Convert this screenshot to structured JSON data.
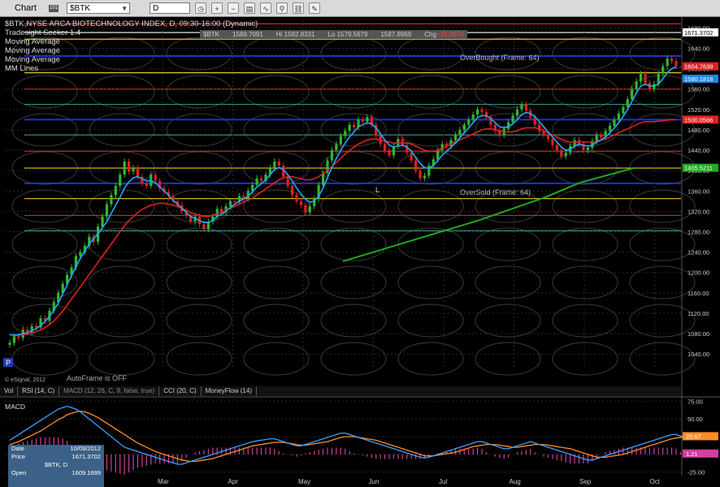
{
  "toolbar": {
    "title": "Chart",
    "symbol": "$BTK",
    "interval": "D",
    "badge": "101"
  },
  "header": {
    "title_line": "$BTK,NYSE ARCA BIOTECHNOLOGY INDEX, D, 09:30-16:00 (Dynamic)",
    "studies": [
      "Tradesight Seeker 1.4",
      "Moving Average",
      "Moving Average",
      "Moving Average",
      "MM Lines"
    ]
  },
  "quote": {
    "symbol": "$BTK",
    "high": "1589.7091",
    "high_label": "Hi",
    "high_value": "1592.8331",
    "low_label": "Lo",
    "low_value": "1579.5679",
    "last": "1587.8969",
    "change_label": "Chg",
    "change": "-15.0976"
  },
  "annotations": {
    "overbought": "OverBought (Frame: 64)",
    "oversold": "OverSold (Frame: 64)",
    "copyright": "© eSignal, 2012",
    "autoframe": "AutoFrame is OFF",
    "p_marker": "P",
    "l_marker": "L"
  },
  "tabs": [
    "Vol",
    "RSI (14, C)",
    "MACD (12, 26, C, 9, false, true)",
    "CCI (20, C)",
    "MoneyFlow (14)"
  ],
  "indicator": {
    "name": "MACD"
  },
  "infobox": {
    "date_label": "Date",
    "date": "10/09/2012",
    "price_label": "Price",
    "price": "1671.3702",
    "symbol": "$BTK, D",
    "open_label": "Open",
    "open": "1609.1699"
  },
  "colors": {
    "up": "#2fb82f",
    "down": "#e02020",
    "ma_blue": "#22a8ff",
    "ma_red": "#e02020",
    "ma_green": "#1eaa1e",
    "macd_line": "#3aa0ff",
    "signal_line": "#ff8c2a",
    "hist": "#d040a0"
  },
  "chart_data": [
    {
      "type": "candlestick",
      "x_tick_labels": [
        "Mar",
        "Apr",
        "May",
        "Jun",
        "Jul",
        "Aug",
        "Sep",
        "Oct"
      ],
      "y_ticks": [
        1040,
        1080,
        1120,
        1160,
        1200,
        1240,
        1280,
        1320,
        1360,
        1400,
        1440,
        1480,
        1520,
        1560,
        1600,
        1640,
        1680
      ],
      "ylim": [
        1010,
        1695
      ],
      "price_labels": [
        {
          "value": 1671.3702,
          "text": "1671.3702",
          "bg": "#ffffff",
          "fg": "#000000"
        },
        {
          "value": 1604.7639,
          "text": "1604.7639",
          "bg": "#e02020",
          "fg": "#ffffff"
        },
        {
          "value": 1580.1818,
          "text": "1580.1818",
          "bg": "#1e88e5",
          "fg": "#ffffff"
        },
        {
          "value": 1500.0566,
          "text": "1500.0566",
          "bg": "#e02020",
          "fg": "#ffffff"
        },
        {
          "value": 1405.5211,
          "text": "1405.5211",
          "bg": "#22aa22",
          "fg": "#ffffff"
        }
      ],
      "series": [
        {
          "values": [
            1062,
            1075,
            1072,
            1088,
            1082,
            1095,
            1092,
            1110,
            1105,
            1125,
            1142,
            1160,
            1178,
            1195,
            1210,
            1232,
            1240,
            1252,
            1270,
            1260,
            1290,
            1310,
            1334,
            1352,
            1370,
            1392,
            1418,
            1398,
            1405,
            1388,
            1375,
            1370,
            1392,
            1380,
            1365,
            1358,
            1350,
            1340,
            1332,
            1320,
            1312,
            1300,
            1310,
            1295,
            1285,
            1300,
            1310,
            1325,
            1318,
            1330,
            1340,
            1338,
            1350,
            1345,
            1360,
            1372,
            1385,
            1380,
            1392,
            1405,
            1418,
            1410,
            1388,
            1370,
            1352,
            1340,
            1332,
            1318,
            1330,
            1345,
            1372,
            1395,
            1420,
            1440,
            1452,
            1468,
            1478,
            1490,
            1485,
            1500,
            1496,
            1505,
            1490,
            1470,
            1452,
            1440,
            1430,
            1448,
            1462,
            1450,
            1435,
            1420,
            1400,
            1385,
            1390,
            1410,
            1422,
            1440,
            1452,
            1448,
            1460,
            1470,
            1480,
            1490,
            1500,
            1510,
            1520,
            1515,
            1505,
            1490,
            1478,
            1470,
            1482,
            1495,
            1508,
            1520,
            1530,
            1518,
            1505,
            1490,
            1478,
            1470,
            1462,
            1450,
            1440,
            1428,
            1435,
            1448,
            1460,
            1452,
            1440,
            1445,
            1458,
            1470,
            1465,
            1478,
            1488,
            1500,
            1512,
            1525,
            1540,
            1560,
            1575,
            1590,
            1572,
            1560,
            1570,
            1590,
            1605,
            1620,
            1615,
            1605
          ]
        },
        {
          "name": "",
          "values": [
            1078,
            1077,
            1078,
            1080,
            1082,
            1086,
            1090,
            1096,
            1104,
            1114,
            1126,
            1140,
            1158,
            1176,
            1194,
            1212,
            1228,
            1242,
            1256,
            1266,
            1276,
            1288,
            1300,
            1316,
            1332,
            1348,
            1366,
            1378,
            1386,
            1388,
            1384,
            1380,
            1380,
            1376,
            1368,
            1360,
            1352,
            1342,
            1334,
            1326,
            1318,
            1310,
            1306,
            1302,
            1298,
            1298,
            1302,
            1310,
            1314,
            1320,
            1328,
            1334,
            1340,
            1344,
            1350,
            1358,
            1368,
            1374,
            1382,
            1392,
            1402,
            1406,
            1402,
            1392,
            1380,
            1366,
            1354,
            1344,
            1338,
            1340,
            1350,
            1366,
            1386,
            1406,
            1424,
            1440,
            1454,
            1466,
            1476,
            1486,
            1490,
            1494,
            1492,
            1484,
            1472,
            1460,
            1450,
            1446,
            1448,
            1450,
            1446,
            1438,
            1426,
            1414,
            1406,
            1404,
            1410,
            1420,
            1430,
            1438,
            1446,
            1454,
            1464,
            1474,
            1484,
            1494,
            1504,
            1508,
            1508,
            1502,
            1494,
            1486,
            1484,
            1486,
            1492,
            1500,
            1510,
            1514,
            1512,
            1506,
            1496,
            1486,
            1476,
            1466,
            1456,
            1446,
            1440,
            1442,
            1448,
            1452,
            1450,
            1448,
            1450,
            1456,
            1460,
            1466,
            1474,
            1484,
            1494,
            1506,
            1520,
            1536,
            1552,
            1566,
            1570,
            1566,
            1566,
            1570,
            1580,
            1592,
            1600,
            1604
          ]
        },
        {
          "name": "",
          "values": [
            1078,
            1077,
            1077,
            1078,
            1079,
            1081,
            1084,
            1087,
            1092,
            1098,
            1105,
            1114,
            1124,
            1136,
            1148,
            1160,
            1172,
            1184,
            1196,
            1208,
            1220,
            1232,
            1244,
            1256,
            1268,
            1280,
            1292,
            1302,
            1310,
            1318,
            1324,
            1328,
            1332,
            1334,
            1336,
            1336,
            1334,
            1332,
            1330,
            1326,
            1322,
            1318,
            1315,
            1312,
            1310,
            1310,
            1312,
            1315,
            1318,
            1322,
            1326,
            1330,
            1334,
            1338,
            1342,
            1346,
            1352,
            1358,
            1364,
            1370,
            1376,
            1382,
            1386,
            1388,
            1388,
            1386,
            1384,
            1382,
            1382,
            1384,
            1388,
            1394,
            1400,
            1408,
            1416,
            1424,
            1432,
            1440,
            1446,
            1452,
            1456,
            1460,
            1462,
            1462,
            1460,
            1458,
            1456,
            1454,
            1454,
            1454,
            1454,
            1452,
            1448,
            1444,
            1440,
            1438,
            1438,
            1440,
            1444,
            1448,
            1452,
            1456,
            1460,
            1464,
            1468,
            1472,
            1476,
            1480,
            1482,
            1482,
            1480,
            1478,
            1476,
            1476,
            1476,
            1478,
            1482,
            1484,
            1484,
            1484,
            1482,
            1478,
            1474,
            1470,
            1466,
            1462,
            1458,
            1456,
            1456,
            1456,
            1456,
            1456,
            1456,
            1458,
            1460,
            1462,
            1466,
            1470,
            1474,
            1478,
            1482,
            1486,
            1490,
            1494,
            1496,
            1496,
            1496,
            1497,
            1498,
            1499,
            1500,
            1500
          ]
        },
        {
          "name": "",
          "values": [
            [
              0.5,
              1222
            ],
            [
              0.6,
              1262
            ],
            [
              0.7,
              1302
            ],
            [
              0.8,
              1348
            ],
            [
              0.85,
              1376
            ],
            [
              0.93,
              1405
            ]
          ]
        }
      ],
      "horizontal_levels": [
        {
          "value": 1688,
          "color": "#e02020"
        },
        {
          "value": 1671,
          "color": "#ffffff"
        },
        {
          "value": 1658,
          "color": "#e8c820"
        },
        {
          "value": 1625,
          "color": "#2030d0"
        },
        {
          "value": 1592,
          "color": "#e8c820"
        },
        {
          "value": 1560,
          "color": "#e02020"
        },
        {
          "value": 1530,
          "color": "#3a8a8a"
        },
        {
          "value": 1500,
          "color": "#2030d0"
        },
        {
          "value": 1470,
          "color": "#3a8a8a"
        },
        {
          "value": 1438,
          "color": "#e02020"
        },
        {
          "value": 1405,
          "color": "#e8c820"
        },
        {
          "value": 1375,
          "color": "#2030d0"
        },
        {
          "value": 1345,
          "color": "#e8c820"
        },
        {
          "value": 1312,
          "color": "#e02020"
        },
        {
          "value": 1282,
          "color": "#3a8a8a"
        }
      ]
    },
    {
      "type": "line",
      "y_ticks": [
        -25.0,
        0.0,
        25.0,
        50.0,
        75.0
      ],
      "ylim": [
        -30,
        80
      ],
      "value_labels": [
        {
          "value": 25.67,
          "text": "25.67",
          "bg": "#ff8c2a"
        },
        {
          "value": 1.21,
          "text": "1.21",
          "bg": "#d040a0"
        }
      ],
      "series": [
        {
          "values": [
            20,
            24,
            28,
            32,
            36,
            40,
            44,
            48,
            52,
            56,
            60,
            64,
            66,
            68,
            66,
            64,
            60,
            55,
            50,
            45,
            40,
            35,
            30,
            25,
            20,
            15,
            10,
            8,
            6,
            4,
            2,
            0,
            -2,
            -4,
            -6,
            -8,
            -10,
            -12,
            -14,
            -14,
            -12,
            -10,
            -8,
            -6,
            -4,
            -2,
            0,
            2,
            4,
            6,
            8,
            10,
            12,
            14,
            16,
            18,
            19,
            20,
            21,
            22,
            22,
            20,
            18,
            16,
            14,
            12,
            12,
            14,
            16,
            18,
            20,
            22,
            24,
            26,
            28,
            30,
            30,
            28,
            26,
            24,
            22,
            20,
            18,
            16,
            14,
            12,
            10,
            8,
            6,
            4,
            2,
            0,
            -2,
            -4,
            -5,
            -4,
            -2,
            0,
            2,
            4,
            6,
            8,
            10,
            12,
            14,
            16,
            18,
            18,
            16,
            14,
            12,
            10,
            8,
            8,
            10,
            12,
            14,
            16,
            18,
            16,
            14,
            12,
            10,
            8,
            6,
            4,
            2,
            0,
            -2,
            -4,
            -6,
            -8,
            -8,
            -6,
            -4,
            -2,
            0,
            2,
            4,
            6,
            8,
            10,
            12,
            14,
            16,
            18,
            20,
            22,
            24,
            26,
            28,
            28,
            26,
            24,
            24,
            25,
            26,
            26,
            26
          ]
        },
        {
          "values": [
            14,
            16,
            18,
            21,
            24,
            27,
            30,
            33,
            37,
            41,
            45,
            49,
            52,
            56,
            58,
            60,
            61,
            60,
            58,
            55,
            52,
            48,
            44,
            40,
            36,
            32,
            28,
            24,
            20,
            16,
            13,
            10,
            7,
            4,
            2,
            0,
            -2,
            -4,
            -6,
            -8,
            -9,
            -10,
            -10,
            -9,
            -8,
            -7,
            -6,
            -4,
            -2,
            0,
            2,
            4,
            6,
            8,
            10,
            12,
            13,
            14,
            15,
            16,
            17,
            17,
            17,
            16,
            15,
            14,
            13,
            13,
            14,
            15,
            16,
            17,
            18,
            20,
            22,
            24,
            25,
            25,
            25,
            24,
            23,
            22,
            21,
            20,
            18,
            16,
            14,
            12,
            10,
            8,
            6,
            4,
            2,
            0,
            -2,
            -2,
            -2,
            -1,
            0,
            1,
            2,
            3,
            5,
            7,
            9,
            11,
            12,
            13,
            14,
            14,
            14,
            13,
            12,
            11,
            10,
            10,
            11,
            12,
            13,
            14,
            14,
            14,
            13,
            12,
            11,
            10,
            9,
            8,
            6,
            4,
            2,
            0,
            -2,
            -4,
            -4,
            -4,
            -3,
            -2,
            -1,
            0,
            2,
            4,
            6,
            8,
            10,
            12,
            14,
            16,
            18,
            20,
            22,
            23,
            24,
            24,
            24,
            25,
            25,
            25,
            26
          ]
        }
      ]
    }
  ]
}
